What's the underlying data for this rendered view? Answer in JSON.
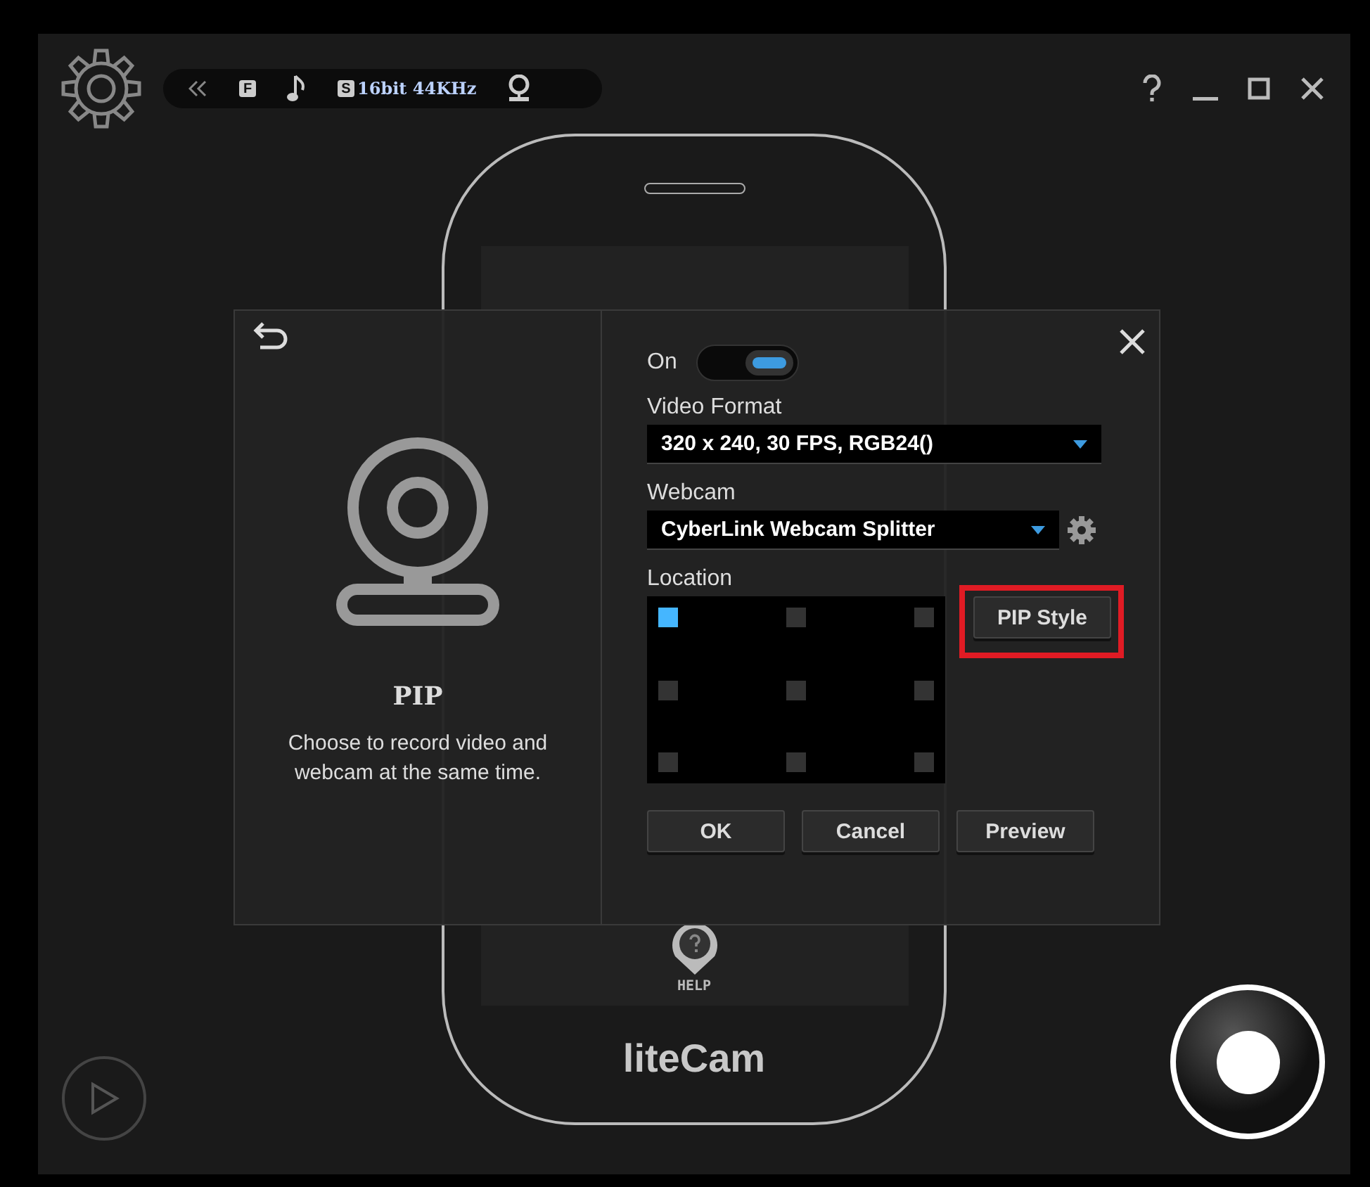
{
  "toolbar": {
    "format_badge": "F",
    "audio_badge": "S",
    "audio_quality": "16bit 44KHz"
  },
  "phone": {
    "help_label": "HELP",
    "logo": "liteCam"
  },
  "dialog": {
    "title": "PIP",
    "description": "Choose to record video and webcam at the same time.",
    "on_label": "On",
    "on": true,
    "video_format": {
      "label": "Video Format",
      "value": "320 x 240, 30 FPS, RGB24()"
    },
    "webcam": {
      "label": "Webcam",
      "value": "CyberLink Webcam Splitter"
    },
    "location": {
      "label": "Location",
      "positions": [
        {
          "selected": true
        },
        {
          "selected": false
        },
        {
          "selected": false
        },
        {
          "selected": false
        },
        {
          "selected": false
        },
        {
          "selected": false
        },
        {
          "selected": false
        },
        {
          "selected": false
        },
        {
          "selected": false
        }
      ]
    },
    "pip_style": {
      "label": "PIP Style",
      "highlighted": true
    },
    "buttons": [
      "OK",
      "Cancel",
      "Preview"
    ]
  }
}
